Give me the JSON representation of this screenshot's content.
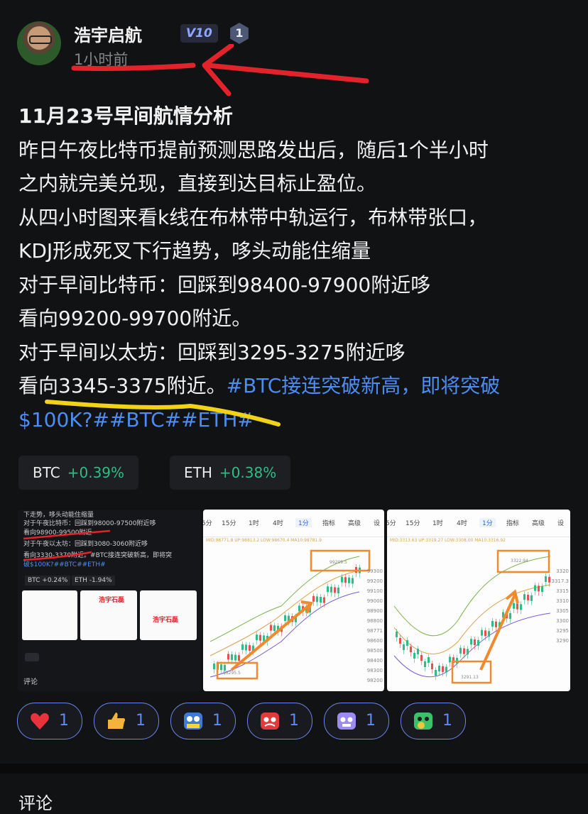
{
  "post": {
    "author": "浩宇启航",
    "vip": "V10",
    "level": "1",
    "time": "1小时前"
  },
  "content": {
    "title": "11月23号早间航情分析",
    "lines": [
      "昨日午夜比特币提前预测思路发出后，随后1个半小时",
      "之内就完美兑现，直接到达目标止盈位。",
      "从四小时图来看k线在布林带中轨运行，布林带张口，",
      "KDJ形成死叉下行趋势，哆头动能住缩量",
      "对于早间比特币：回踩到98400-97900附近哆",
      "看向99200-99700附近。",
      "对于早间以太坊：回踩到3295-3275附近哆",
      "看向3345-3375附近。"
    ],
    "hashtag_inline": "#BTC接连突破新高，即将突破",
    "hashtag_line2": "$100K?##BTC##ETH#"
  },
  "tickers": [
    {
      "symbol": "BTC",
      "change": "+0.39%"
    },
    {
      "symbol": "ETH",
      "change": "+0.38%"
    }
  ],
  "image1": {
    "lines": [
      "下走势，哆头动能住缩量",
      "对于午夜比特币：回踩到98000-97500附近哆",
      "看向98900-99500附近",
      "对于午夜以太坊：回踩到3080-3060附近哆",
      "看向3330-3370附近。#BTC接连突破新高，即将突",
      "破$100K?##BTC##ETH#"
    ],
    "btc": "BTC +0.24%",
    "eth": "ETH -1.94%",
    "brand": "浩宇石磊",
    "footer": "评论"
  },
  "image2": {
    "timeframes": [
      "5分",
      "15分",
      "1时",
      "4时",
      "1分",
      "指标",
      "高级",
      "设"
    ],
    "ma": "MID:98771.8  UP:98813.2  LOW:98670.4  MA10:98781.9",
    "high_label": "99209.5",
    "low_label": "98295.5",
    "y_ticks": [
      "99300",
      "99200",
      "99100",
      "99000",
      "98900",
      "98800",
      "98771",
      "98600",
      "98500",
      "98400",
      "98300",
      "98200"
    ]
  },
  "image3": {
    "timeframes": [
      "5分",
      "15分",
      "1时",
      "4时",
      "1分",
      "指标",
      "高级",
      "设"
    ],
    "ma": "MID:3313.63  UP:3319.27  LOW:3308.00  MA10:3316.92",
    "high_label": "3322.94",
    "low_label": "3291.13",
    "y_ticks": [
      "3320",
      "3317.3",
      "3315",
      "3310",
      "3305",
      "3300",
      "3295",
      "3290"
    ]
  },
  "reactions": [
    {
      "icon": "heart-icon",
      "count": "1",
      "color": "#e8323c"
    },
    {
      "icon": "thumbs-up-icon",
      "count": "1",
      "color": "#f4b43c"
    },
    {
      "icon": "hodl-face-icon",
      "count": "1",
      "color": "#3f7bd6"
    },
    {
      "icon": "angry-face-icon",
      "count": "1",
      "color": "#e23b3b"
    },
    {
      "icon": "purple-face-icon",
      "count": "1",
      "color": "#9c8cf0"
    },
    {
      "icon": "green-face-icon",
      "count": "1",
      "color": "#3cc16a"
    }
  ],
  "comments": {
    "title": "评论"
  },
  "colors": {
    "accent": "#4d8cf2",
    "up": "#2dbd85",
    "annotation_red": "#e3232b",
    "annotation_yellow": "#f2d217"
  }
}
